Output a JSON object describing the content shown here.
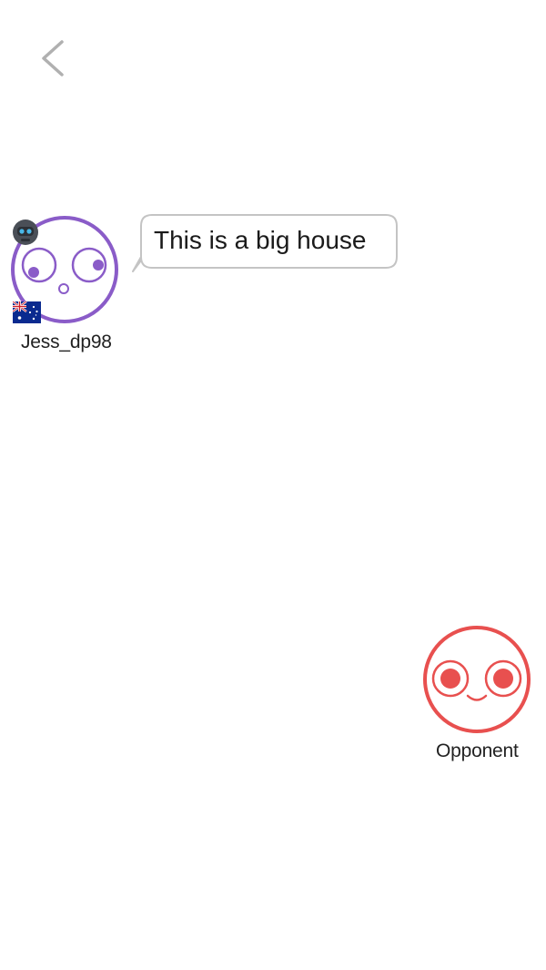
{
  "nav": {
    "back_icon": "chevron-left-icon"
  },
  "player": {
    "name": "Jess_dp98",
    "message": "This is a big house",
    "avatar_color": "#8a5cc8",
    "badge_icon": "robot-icon",
    "flag_icon": "australia-flag-icon"
  },
  "opponent": {
    "name": "Opponent",
    "avatar_color": "#e8504f"
  }
}
